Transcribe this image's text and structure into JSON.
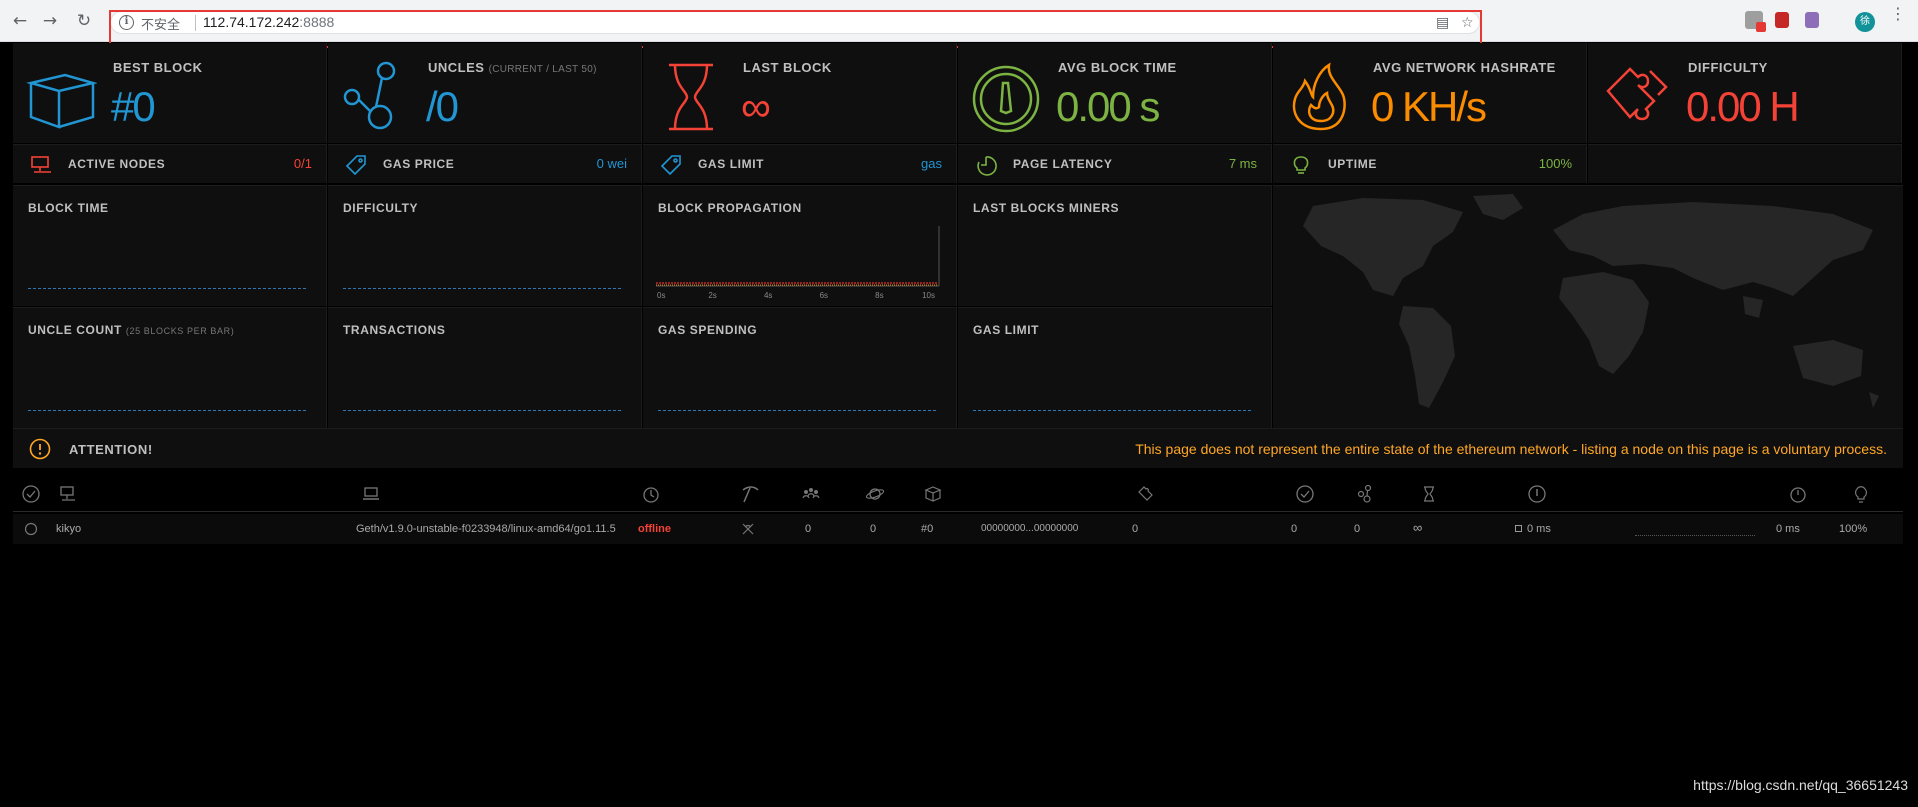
{
  "browser": {
    "insecure_label": "不安全",
    "url_host": "112.74.172.242",
    "url_port": ":8888",
    "avatar_initial": "徐"
  },
  "stats": {
    "best_block": {
      "title": "BEST BLOCK",
      "value": "#0",
      "color": "#2196d3"
    },
    "uncles": {
      "title": "UNCLES",
      "subtitle": "(CURRENT / LAST 50)",
      "value": "/0",
      "color": "#2196d3"
    },
    "last_block": {
      "title": "LAST BLOCK",
      "value": "∞",
      "color": "#f44336"
    },
    "avg_block_time": {
      "title": "AVG BLOCK TIME",
      "value": "0.00 s",
      "color": "#7cb342"
    },
    "avg_hashrate": {
      "title": "AVG NETWORK HASHRATE",
      "value": "0 KH/s",
      "color": "#fb8c00"
    },
    "difficulty": {
      "title": "DIFFICULTY",
      "value": "0.00 H",
      "color": "#f44336"
    }
  },
  "small_stats": {
    "active_nodes": {
      "title": "ACTIVE NODES",
      "value": "0/1",
      "color": "#f44336"
    },
    "gas_price": {
      "title": "GAS PRICE",
      "value": "0 wei",
      "color": "#2196d3"
    },
    "gas_limit": {
      "title": "GAS LIMIT",
      "value": "gas",
      "color": "#2196d3"
    },
    "page_latency": {
      "title": "PAGE LATENCY",
      "value": "7 ms",
      "color": "#7cb342"
    },
    "uptime": {
      "title": "UPTIME",
      "value": "100%",
      "color": "#7cb342"
    }
  },
  "charts": {
    "block_time": "BLOCK TIME",
    "difficulty": "DIFFICULTY",
    "block_propagation": "BLOCK PROPAGATION",
    "last_blocks_miners": "LAST BLOCKS MINERS",
    "uncle_count": "UNCLE COUNT",
    "uncle_count_sub": "(25 BLOCKS PER BAR)",
    "transactions": "TRANSACTIONS",
    "gas_spending": "GAS SPENDING",
    "gas_limit": "GAS LIMIT",
    "propagation_ticks": [
      "0s",
      "2s",
      "4s",
      "6s",
      "8s",
      "10s"
    ]
  },
  "attention": {
    "title": "ATTENTION!",
    "message": "This page does not represent the entire state of the ethereum network - listing a node on this page is a voluntary process."
  },
  "node": {
    "name": "kikyo",
    "client": "Geth/v1.9.0-unstable-f0233948/linux-amd64/go1.11.5",
    "status": "offline",
    "peers": "0",
    "pending": "0",
    "block": "#0",
    "block_hash": "00000000...00000000",
    "difficulty": "0",
    "propagated": "0",
    "uncles": "0",
    "last_block": "∞",
    "propagation_time": "0 ms",
    "avg_propagation": "0 ms",
    "uptime": "100%"
  },
  "watermark": "https://blog.csdn.net/qq_36651243"
}
